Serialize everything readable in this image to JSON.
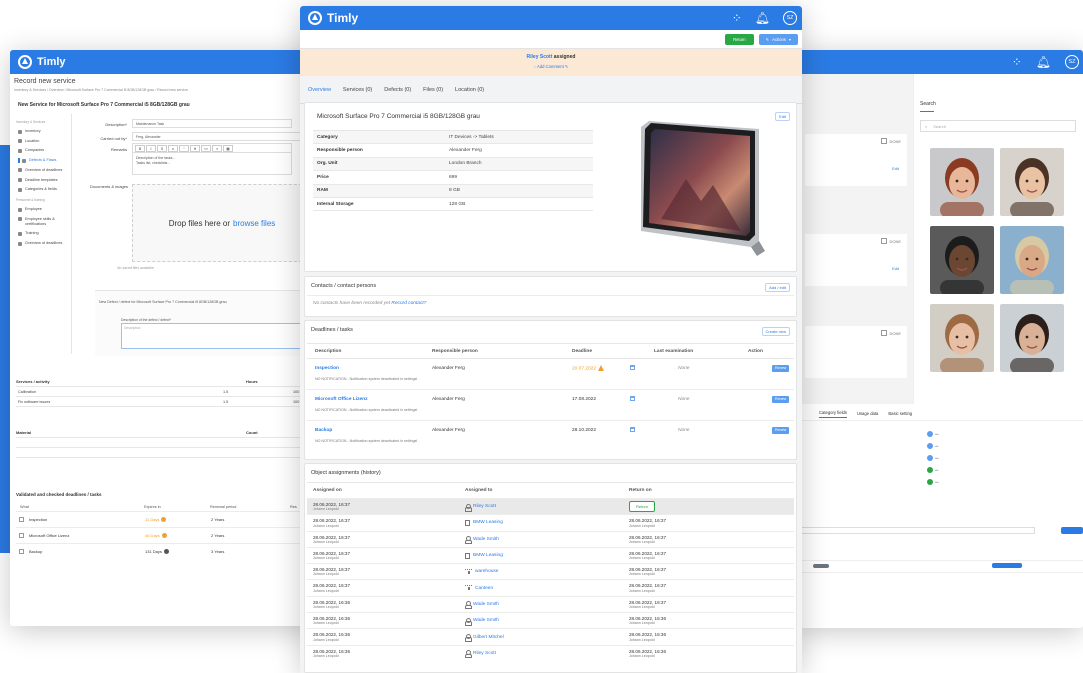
{
  "brand": {
    "name": "Timly",
    "color": "#2b7be4"
  },
  "left_window": {
    "heading": "Record new service",
    "breadcrumb": "Inventory & Services / Overview / Microsoft Surface Pro 7 Commercial i5 8GB/128GB grau / Record new service",
    "title": "New Service for Microsoft Surface Pro 7 Commercial i5 8GB/128GB grau",
    "sidebar": {
      "group1": "Inventory & Services",
      "items1": [
        "Inventory",
        "Location",
        "Companies",
        "Defects & Flaws",
        "Overview of deadlines",
        "Deadline templates",
        "Categories & fields"
      ],
      "group2": "Personnel & training",
      "items2": [
        "Employee",
        "Employee skills & certifications",
        "Training",
        "Overview of deadlines"
      ]
    },
    "form": {
      "description_label": "Description*",
      "description_value": "Maintenance Task",
      "carried_out_label": "Carried out by*",
      "carried_out_value": "Ferg, Alexander",
      "remarks_label": "Remarks",
      "remarks_value": "Description of the tasks...",
      "remarks_value2": "Tasks list, checklists...",
      "documents_label": "Documents & images",
      "drop_text": "Drop files here or",
      "drop_link": "browse files",
      "no_files": "No saved files available"
    },
    "defect": {
      "title": "New Defect / defect for Microsoft Surface Pro 7 Commercial i5 8GB/128GB grau",
      "label": "Description of the defect / defect*",
      "placeholder": "Description"
    },
    "services_table": {
      "col1": "Services / activity",
      "col2": "Hours",
      "rows": [
        {
          "name": "Calibration",
          "hours": "1.5",
          "extra": "100"
        },
        {
          "name": "Fix software issues",
          "hours": "1.5",
          "extra": "100"
        }
      ]
    },
    "material_table": {
      "col1": "Material",
      "col2": "Count"
    },
    "deadlines": {
      "title": "Validated and checked deadlines / tasks",
      "headers": [
        "What",
        "Expires in",
        "Renewal period",
        "Res"
      ],
      "rows": [
        {
          "what": "Inspection",
          "expires": "11 Days",
          "period": "2 Years",
          "warn": true
        },
        {
          "what": "Microsoft Office Lizenz",
          "expires": "46 Days",
          "period": "2 Years",
          "warn": true
        },
        {
          "what": "Backup",
          "expires": "131 Days",
          "period": "3 Years",
          "warn": false
        }
      ]
    }
  },
  "center_window": {
    "user_initials": "SZ",
    "btn_return": "Return",
    "btn_actions": "Actions",
    "assignment": {
      "name": "Riley Scott",
      "text": "assigned",
      "add_comment": "Add Comment"
    },
    "tabs": [
      "Overview",
      "Services (0)",
      "Defects (0)",
      "Files (0)",
      "Location (0)"
    ],
    "overview": {
      "title": "Microsoft Surface Pro 7 Commercial i5 8GB/128GB grau",
      "edit": "Edit",
      "rows": [
        {
          "k": "Category",
          "v": "IT Devices -> Tablets"
        },
        {
          "k": "Responsible person",
          "v": "Alexander Ferg"
        },
        {
          "k": "Org. Unit",
          "v": "London Branch"
        },
        {
          "k": "Price",
          "v": "699"
        },
        {
          "k": "RAM",
          "v": "8 GB"
        },
        {
          "k": "Internal Storage",
          "v": "128 GB"
        }
      ]
    },
    "contacts": {
      "title": "Contacts / contact persons",
      "add_edit": "Add / edit",
      "empty": "No contacts have been recorded yet",
      "record_link": "Record contact?"
    },
    "deadlines": {
      "title": "Deadlines / tasks",
      "create_new": "Create new",
      "headers": [
        "Description",
        "Responsible person",
        "Deadline",
        "Last examination",
        "Action"
      ],
      "rows": [
        {
          "desc": "Inspection",
          "person": "Alexander Ferg",
          "deadline": "20.07.2022",
          "warn": true,
          "last": "None",
          "action": "Renew",
          "note": "NO NOTIFICATION - Notification system deactivated in settings!"
        },
        {
          "desc": "Microsoft Office Lizenz",
          "person": "Alexander Ferg",
          "deadline": "17.08.2022",
          "warn": false,
          "last": "None",
          "action": "Renew",
          "note": "NO NOTIFICATION - Notification system deactivated in settings!"
        },
        {
          "desc": "Backup",
          "person": "Alexander Ferg",
          "deadline": "28.10.2022",
          "warn": false,
          "last": "None",
          "action": "Renew",
          "note": "NO NOTIFICATION - Notification system deactivated in settings!"
        }
      ]
    },
    "history": {
      "title": "Object assignments (history)",
      "headers": [
        "Assigned on",
        "Assigned to",
        "Return on"
      ],
      "rows": [
        {
          "on": "28.06.2022, 16:37",
          "by": "Johann Leopold",
          "to": "Riley Scott",
          "icon": "person",
          "ret": "Return",
          "ret_by": ""
        },
        {
          "on": "28.06.2022, 16:37",
          "by": "Johann Leopold",
          "to": "BMW Leasing",
          "icon": "building",
          "ret": "28.06.2022, 16:37",
          "ret_by": "Johann Leopold"
        },
        {
          "on": "28.06.2022, 16:37",
          "by": "Johann Leopold",
          "to": "Wade Smith",
          "icon": "person",
          "ret": "28.06.2022, 16:37",
          "ret_by": "Johann Leopold"
        },
        {
          "on": "28.06.2022, 16:37",
          "by": "Johann Leopold",
          "to": "BMW Leasing",
          "icon": "building",
          "ret": "28.06.2022, 16:37",
          "ret_by": "Johann Leopold"
        },
        {
          "on": "28.06.2022, 16:37",
          "by": "Johann Leopold",
          "to": "warehouse",
          "icon": "org",
          "ret": "28.06.2022, 16:37",
          "ret_by": "Johann Leopold"
        },
        {
          "on": "28.06.2022, 16:37",
          "by": "Johann Leopold",
          "to": "Canteen",
          "icon": "org",
          "ret": "28.06.2022, 16:37",
          "ret_by": "Johann Leopold"
        },
        {
          "on": "28.06.2022, 16:36",
          "by": "Johann Leopold",
          "to": "Wade Smith",
          "icon": "person",
          "ret": "28.06.2022, 16:37",
          "ret_by": "Johann Leopold"
        },
        {
          "on": "28.06.2022, 16:36",
          "by": "Johann Leopold",
          "to": "Wade Smith",
          "icon": "person",
          "ret": "28.06.2022, 16:36",
          "ret_by": "Johann Leopold"
        },
        {
          "on": "28.06.2022, 16:36",
          "by": "Johann Leopold",
          "to": "Gilbert Mitchel",
          "icon": "person",
          "ret": "28.06.2022, 16:36",
          "ret_by": "Johann Leopold"
        },
        {
          "on": "28.06.2022, 16:36",
          "by": "Johann Leopold",
          "to": "Riley Scott",
          "icon": "person",
          "ret": "28.06.2022, 16:36",
          "ret_by": "Johann Leopold"
        }
      ]
    }
  },
  "right_window": {
    "user_initials": "SZ",
    "done_label": "DONE",
    "edit_label": "Edit",
    "search_title": "Search",
    "search_placeholder": "Search",
    "tabs": [
      "Category fields",
      "Usage data",
      "Basic setting"
    ],
    "photos": [
      {
        "skin": "#e8b79a",
        "hair": "#8a3b22",
        "bg": "#c9c9cc"
      },
      {
        "skin": "#e9c2a4",
        "hair": "#4a3324",
        "bg": "#d7d2cc"
      },
      {
        "skin": "#6b4632",
        "hair": "#1c1c1c",
        "bg": "#5a5a5a"
      },
      {
        "skin": "#d9a987",
        "hair": "#d7c9a3",
        "bg": "#8ab0cd"
      },
      {
        "skin": "#e6bfa5",
        "hair": "#9d6a44",
        "bg": "#d2cdc5"
      },
      {
        "skin": "#d9b196",
        "hair": "#2a1f1a",
        "bg": "#cbd0d4"
      }
    ]
  }
}
